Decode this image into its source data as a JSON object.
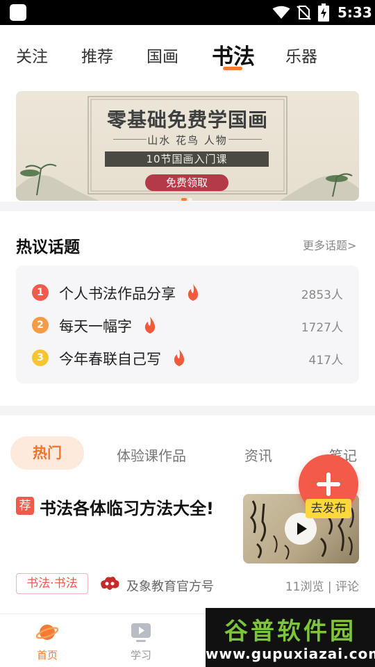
{
  "status_bar": {
    "time": "5:33",
    "icons": [
      "wifi-icon",
      "no-sim-icon",
      "battery-charging-icon"
    ]
  },
  "top_tabs": [
    {
      "label": "关注"
    },
    {
      "label": "推荐"
    },
    {
      "label": "国画"
    },
    {
      "label": "书法",
      "active": true
    },
    {
      "label": "乐器"
    }
  ],
  "banner": {
    "title": "零基础免费学国画",
    "subtitle": "山水 花鸟 人物",
    "course": "10节国画入门课",
    "button": "免费领取"
  },
  "hot_topics": {
    "title": "热议话题",
    "more": "更多话题>",
    "items": [
      {
        "rank": "1",
        "name": "个人书法作品分享",
        "count": "2853人",
        "rank_color": "#f15b4e"
      },
      {
        "rank": "2",
        "name": "每天一幅字",
        "count": "1727人",
        "rank_color": "#f59b48"
      },
      {
        "rank": "3",
        "name": "今年春联自己写",
        "count": "417人",
        "rank_color": "#f7c531"
      }
    ]
  },
  "feed_tabs": [
    {
      "label": "热门",
      "active": true
    },
    {
      "label": "体验课作品"
    },
    {
      "label": "资讯"
    },
    {
      "label": "笔记"
    }
  ],
  "fab": {
    "label": "去发布"
  },
  "article": {
    "badge": "荐",
    "title": "书法各体临习方法大全!",
    "tag": "书法·书法",
    "author": "及象教育官方号",
    "stats": "11浏览 | 评论"
  },
  "bottom_nav": [
    {
      "label": "首页",
      "icon": "planet-icon",
      "active": true
    },
    {
      "label": "学习",
      "icon": "play-video-icon"
    }
  ],
  "watermark": {
    "top": "谷普软件园",
    "bottom": "www.gupuxiazai.com"
  },
  "colors": {
    "accent": "#f37b34",
    "fab": "#f45a4a",
    "fab_label": "#ffd83b",
    "banner_button": "#b53a47"
  }
}
